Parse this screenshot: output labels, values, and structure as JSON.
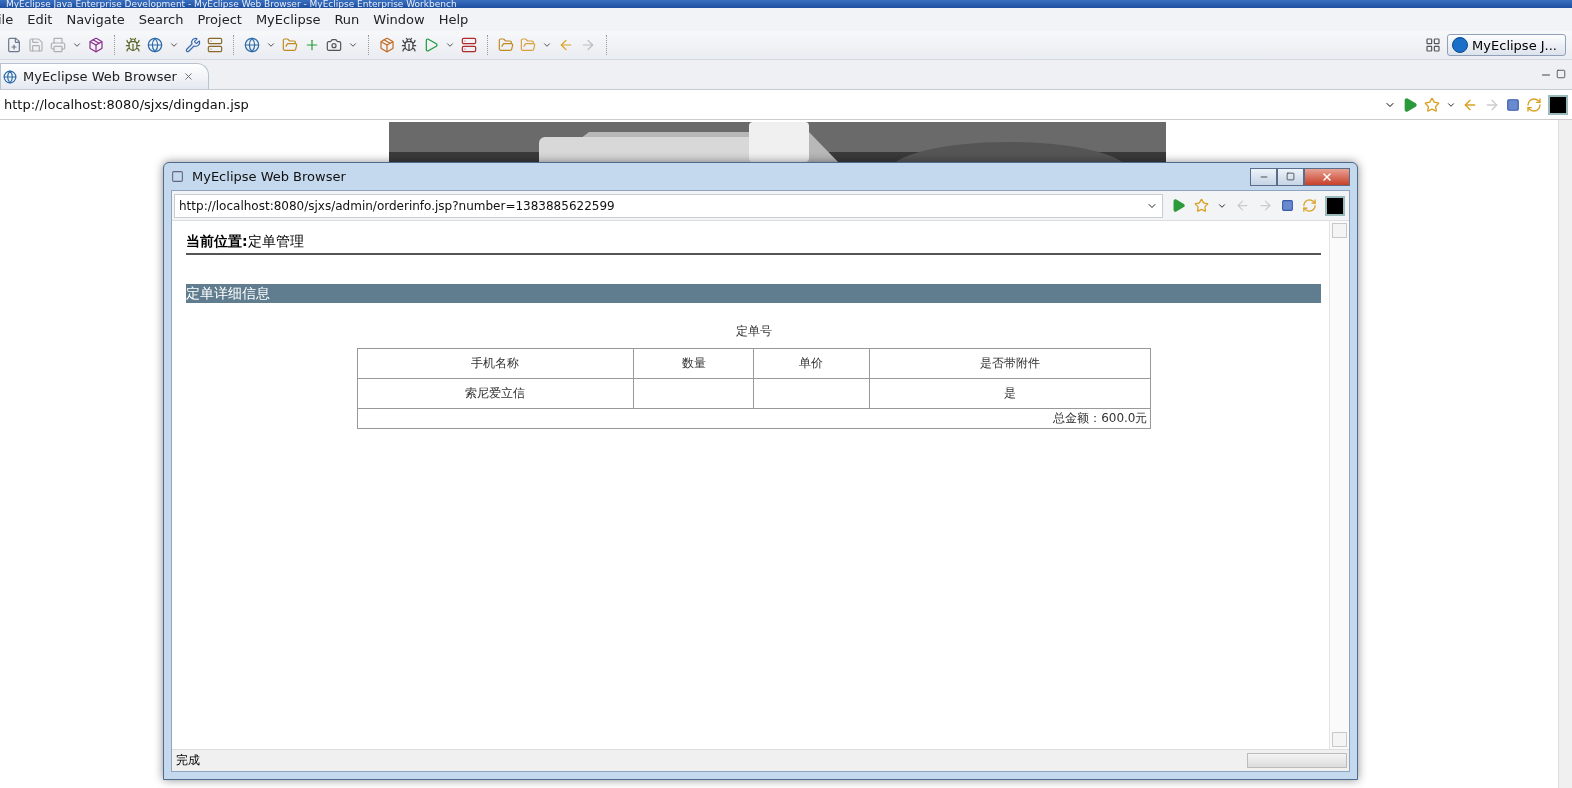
{
  "window": {
    "title": "MyEclipse Java Enterprise Development - MyEclipse Web Browser - MyEclipse Enterprise Workbench"
  },
  "menu": [
    "ile",
    "Edit",
    "Navigate",
    "Search",
    "Project",
    "MyEclipse",
    "Run",
    "Window",
    "Help"
  ],
  "perspective": {
    "label": "MyEclipse J..."
  },
  "editor_tab": {
    "label": "MyEclipse Web Browser",
    "selected": true
  },
  "address": "http://localhost:8080/sjxs/dingdan.jsp",
  "popup": {
    "title": "MyEclipse Web Browser",
    "url": "http://localhost:8080/sjxs/admin/orderinfo.jsp?number=1383885622599",
    "breadcrumb": "**当前位置:**定单管理",
    "section": "定单详细信息",
    "order_label": "定单号",
    "table": {
      "columns": [
        "手机名称",
        "数量",
        "单价",
        "是否带附件"
      ],
      "rows": [
        [
          "索尼爱立信",
          null,
          null,
          "是"
        ]
      ],
      "total": "总金额：600.0元"
    },
    "status": "完成"
  }
}
